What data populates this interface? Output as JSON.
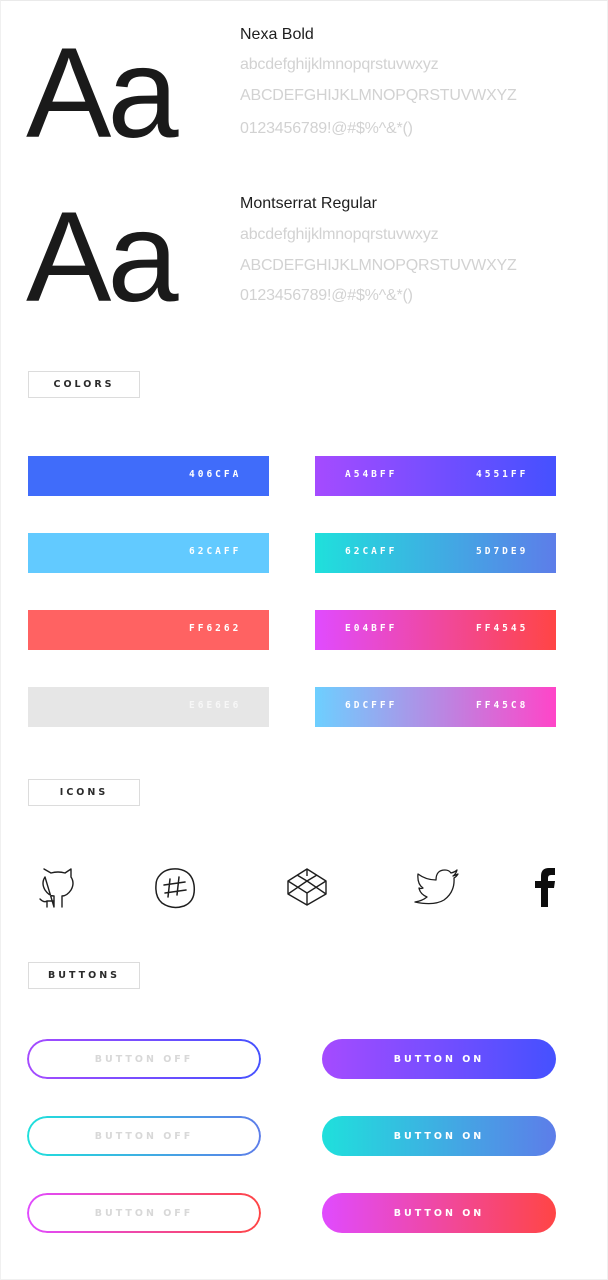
{
  "typography": [
    {
      "sample_glyph": "Aa",
      "font_name": "Nexa Bold",
      "lowercase": "abcdefghijklmnopqrstuvwxyz",
      "uppercase": "ABCDEFGHIJKLMNOPQRSTUVWXYZ",
      "digits_symbols": "0123456789!@#$%^&*()"
    },
    {
      "sample_glyph": "Aa",
      "font_name": "Montserrat Regular",
      "lowercase": "abcdefghijklmnopqrstuvwxyz",
      "uppercase": "ABCDEFGHIJKLMNOPQRSTUVWXYZ",
      "digits_symbols": "0123456789!@#$%^&*()"
    }
  ],
  "sections": {
    "colors": "COLORS",
    "icons": "ICONS",
    "buttons": "BUTTONS"
  },
  "colors": {
    "solid": [
      {
        "label": "406CFA",
        "hex": "#406CFA",
        "text_color": "#ffffff"
      },
      {
        "label": "62CAFF",
        "hex": "#62CAFF",
        "text_color": "#ffffff"
      },
      {
        "label": "FF6262",
        "hex": "#FF6262",
        "text_color": "#ffffff"
      },
      {
        "label": "E6E6E6",
        "hex": "#E6E6E6",
        "text_color": "#f7f7f7"
      }
    ],
    "gradients": [
      {
        "start_label": "A54BFF",
        "end_label": "4551FF",
        "start": "#A54BFF",
        "end": "#4551FF"
      },
      {
        "start_label": "62CAFF",
        "end_label": "5D7DE9",
        "start": "#1FE0DC",
        "end": "#5D7DE9"
      },
      {
        "start_label": "E04BFF",
        "end_label": "FF4545",
        "start": "#E04BFF",
        "end": "#FF4545"
      },
      {
        "start_label": "6DCFFF",
        "end_label": "FF45C8",
        "start": "#6DCFFF",
        "end": "#FF45C8"
      }
    ]
  },
  "icons": [
    "github-icon",
    "slack-icon",
    "codepen-icon",
    "twitter-icon",
    "facebook-icon"
  ],
  "buttons": {
    "off_label": "BUTTON OFF",
    "on_label": "BUTTON ON",
    "off_text_color": "#d8d8d8"
  }
}
